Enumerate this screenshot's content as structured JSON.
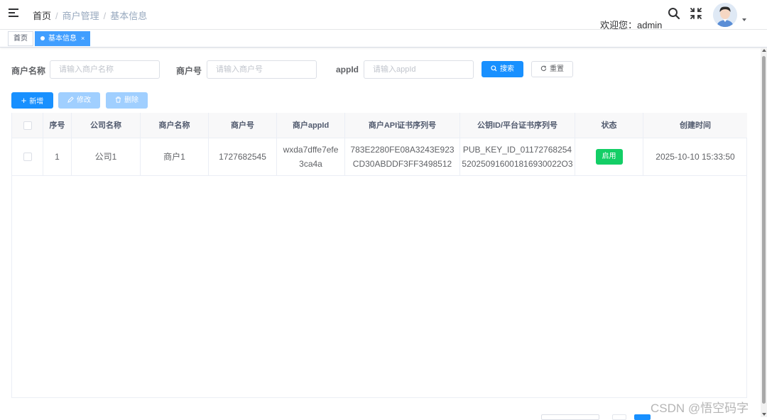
{
  "navbar": {
    "breadcrumb": [
      "首页",
      "商户管理",
      "基本信息"
    ],
    "welcome": "欢迎您：admin"
  },
  "tags": [
    {
      "label": "首页"
    },
    {
      "label": "基本信息",
      "close": "×"
    }
  ],
  "search_form": {
    "merchant_name": {
      "label": "商户名称",
      "placeholder": "请输入商户名称"
    },
    "merchant_no": {
      "label": "商户号",
      "placeholder": "请输入商户号"
    },
    "appid": {
      "label": "appId",
      "placeholder": "请输入appId"
    },
    "search_label": "搜索",
    "reset_label": "重置"
  },
  "toolbar": {
    "add_label": "新增",
    "edit_label": "修改",
    "delete_label": "删除"
  },
  "table": {
    "columns": [
      "序号",
      "公司名称",
      "商户名称",
      "商户号",
      "商户appId",
      "商户API证书序列号",
      "公钥ID/平台证书序列号",
      "状态",
      "创建时间"
    ],
    "rows": [
      {
        "index": "1",
        "company": "公司1",
        "merchant": "商户1",
        "merchant_no": "1727682545",
        "appid_line1": "wxda7dffe7efe",
        "appid_line2": "3ca4a",
        "serial_line1": "783E2280FE08A3243E923",
        "serial_line2": "CD30ABDDF3FF3498512",
        "pubkey_line1": "PUB_KEY_ID_01172768254",
        "pubkey_line2": "520250916001816930022O3",
        "status": "启用",
        "created": "2025-10-10 15:33:50"
      }
    ]
  },
  "watermark": "CSDN @悟空码字",
  "colors": {
    "primary": "#1890ff",
    "tag_active": "#409eff",
    "status_enabled": "#13ce66"
  }
}
